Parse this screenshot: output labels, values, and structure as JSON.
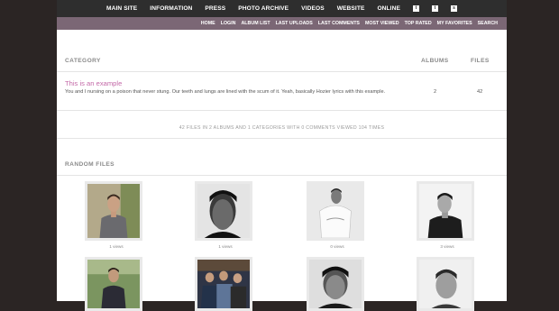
{
  "topnav": {
    "items": [
      "MAIN SITE",
      "INFORMATION",
      "PRESS",
      "PHOTO ARCHIVE",
      "VIDEOS",
      "WEBSITE",
      "ONLINE"
    ],
    "icons": [
      {
        "name": "twitter-icon",
        "glyph": "t"
      },
      {
        "name": "tumblr-icon",
        "glyph": "t"
      },
      {
        "name": "rss-icon",
        "glyph": "s"
      }
    ]
  },
  "subnav": {
    "links": [
      "HOME",
      "LOGIN",
      "ALBUM LIST",
      "LAST UPLOADS",
      "LAST COMMENTS",
      "MOST VIEWED",
      "TOP RATED",
      "MY FAVORITES",
      "SEARCH"
    ]
  },
  "table": {
    "headers": {
      "category": "CATEGORY",
      "albums": "ALBUMS",
      "files": "FILES"
    },
    "rows": [
      {
        "title": "This is an example",
        "description": "You and I nursing on a poison that never stung. Our teeth and lungs are lined with the scum of it. Yeah, basically Hozier lyrics with this example.",
        "albums": "2",
        "files": "42"
      }
    ]
  },
  "stats": "42 FILES IN 2 ALBUMS AND 1 CATEGORIES WITH 0 COMMENTS VIEWED 104 TIMES",
  "random": {
    "heading": "RANDOM FILES",
    "files": [
      {
        "views": "1 views"
      },
      {
        "views": "1 views"
      },
      {
        "views": "0 views"
      },
      {
        "views": "3 views"
      },
      {
        "views": ""
      },
      {
        "views": ""
      },
      {
        "views": ""
      },
      {
        "views": ""
      }
    ]
  },
  "colors": {
    "page_bg": "#2b2524",
    "topnav_bg": "#2e2e2e",
    "subnav_bg": "#7b6775",
    "category_link": "#c46aa8"
  }
}
